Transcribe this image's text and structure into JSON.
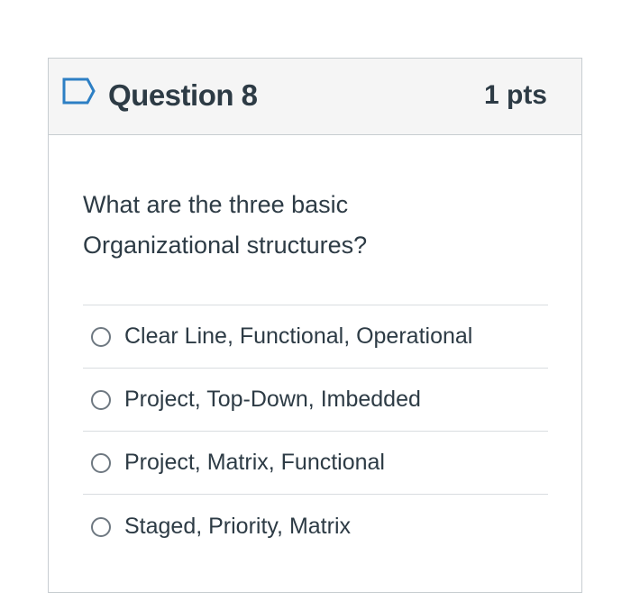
{
  "question": {
    "title": "Question 8",
    "points": "1 pts",
    "text": "What are the three basic Organizational structures?",
    "flag_icon": "flag-outline-icon",
    "answers": [
      {
        "label": "Clear Line, Functional, Operational",
        "selected": false
      },
      {
        "label": "Project, Top-Down, Imbedded",
        "selected": false
      },
      {
        "label": "Project, Matrix, Functional",
        "selected": false
      },
      {
        "label": "Staged, Priority, Matrix",
        "selected": false
      }
    ]
  },
  "colors": {
    "text": "#2d3b45",
    "header_bg": "#f5f5f5",
    "border": "#c7cdd1",
    "flag": "#2d7fc4",
    "radio_border": "#6e7881"
  }
}
